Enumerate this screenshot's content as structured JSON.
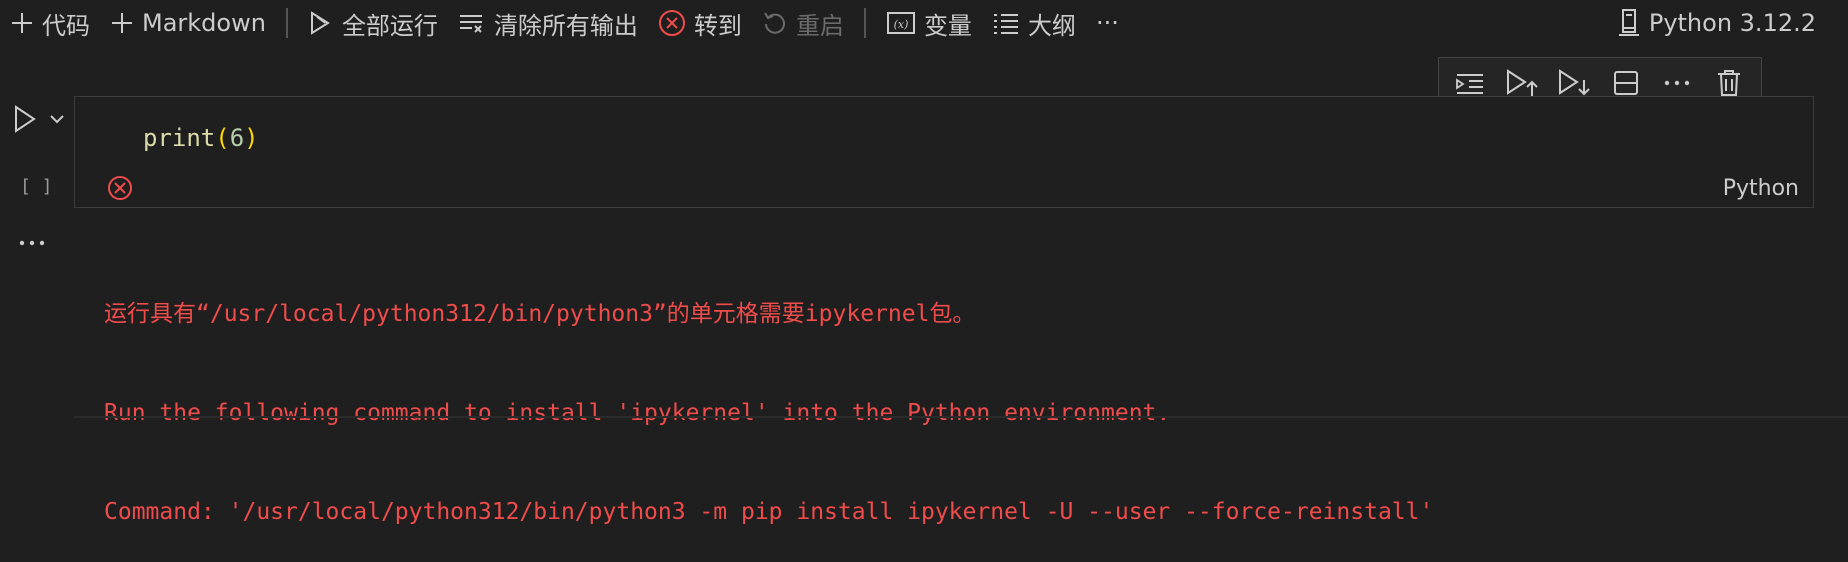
{
  "toolbar": {
    "add_code": "代码",
    "add_markdown": "Markdown",
    "run_all": "全部运行",
    "clear_outputs": "清除所有输出",
    "goto": "转到",
    "restart": "重启",
    "variables": "变量",
    "outline": "大纲",
    "more": "···",
    "kernel": "Python 3.12.2"
  },
  "cell": {
    "execution_count": "[ ]",
    "code": {
      "fn": "print",
      "open": "(",
      "arg": "6",
      "close": ")"
    },
    "language": "Python"
  },
  "output": {
    "lines": [
      "运行具有“/usr/local/python312/bin/python3”的单元格需要ipykernel包。",
      "Run the following command to install 'ipykernel' into the Python environment.",
      "Command: '/usr/local/python312/bin/python3 -m pip install ipykernel -U --user --force-reinstall'"
    ]
  },
  "colors": {
    "background": "#1f1f1f",
    "error": "#f14c4c",
    "text": "#cccccc"
  }
}
